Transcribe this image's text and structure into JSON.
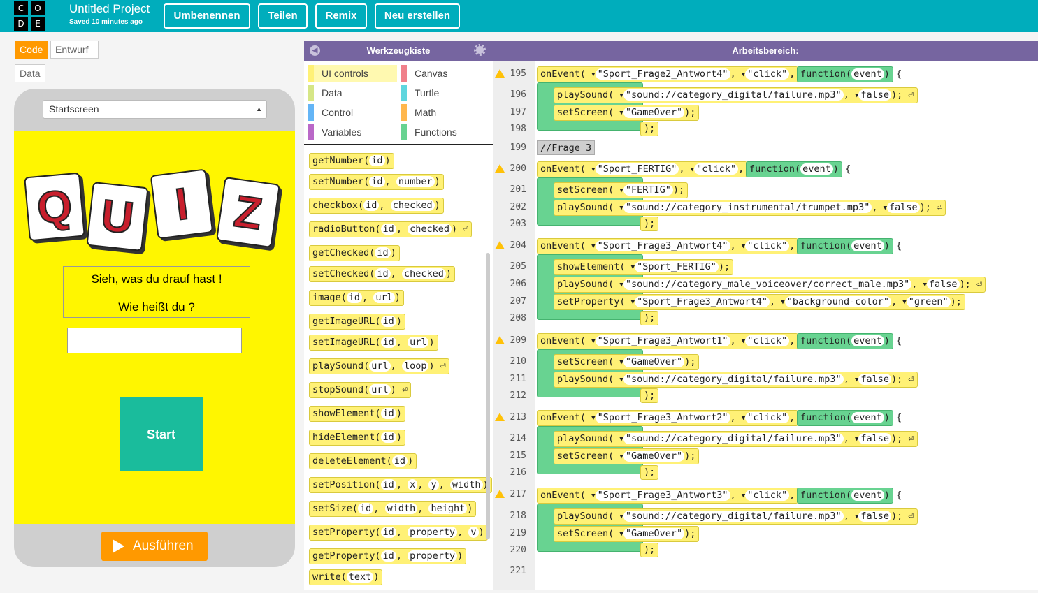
{
  "app": {
    "title": "Untitled Project",
    "saved": "Saved 10 minutes ago",
    "logo": [
      "C",
      "O",
      "D",
      "E"
    ],
    "buttons": {
      "rename": "Umbenennen",
      "share": "Teilen",
      "remix": "Remix",
      "new": "Neu erstellen"
    }
  },
  "mode": {
    "code": "Code",
    "design": "Entwurf",
    "data": "Data"
  },
  "preview": {
    "screen_select": "Startscreen",
    "quiz_letters": [
      "Q",
      "U",
      "I",
      "Z"
    ],
    "line1": "Sieh, was du drauf hast !",
    "line2": "Wie heißt du ?",
    "input_value": "",
    "start": "Start",
    "run": "Ausführen"
  },
  "toolbox": {
    "header": "Werkzeugkiste",
    "categories": [
      {
        "label": "UI controls",
        "color": "#fff176"
      },
      {
        "label": "Canvas",
        "color": "#f0808a"
      },
      {
        "label": "Data",
        "color": "#d6e686"
      },
      {
        "label": "Turtle",
        "color": "#5fd6de"
      },
      {
        "label": "Control",
        "color": "#64b5f6"
      },
      {
        "label": "Math",
        "color": "#ffb74d"
      },
      {
        "label": "Variables",
        "color": "#ba68c8"
      },
      {
        "label": "Functions",
        "color": "#68d391"
      }
    ],
    "blocks": [
      {
        "name": "getNumber",
        "params": [
          "id"
        ],
        "ret": false
      },
      {
        "name": "setNumber",
        "params": [
          "id",
          "number"
        ],
        "ret": false
      },
      {
        "name": "checkbox",
        "params": [
          "id",
          "checked"
        ],
        "ret": false
      },
      {
        "name": "radioButton",
        "params": [
          "id",
          "checked"
        ],
        "ret": true
      },
      {
        "name": "getChecked",
        "params": [
          "id"
        ],
        "ret": false
      },
      {
        "name": "setChecked",
        "params": [
          "id",
          "checked"
        ],
        "ret": false
      },
      {
        "name": "image",
        "params": [
          "id",
          "url"
        ],
        "ret": false
      },
      {
        "name": "getImageURL",
        "params": [
          "id"
        ],
        "ret": false
      },
      {
        "name": "setImageURL",
        "params": [
          "id",
          "url"
        ],
        "ret": false
      },
      {
        "name": "playSound",
        "params": [
          "url",
          "loop"
        ],
        "ret": true
      },
      {
        "name": "stopSound",
        "params": [
          "url"
        ],
        "ret": true
      },
      {
        "name": "showElement",
        "params": [
          "id"
        ],
        "ret": false
      },
      {
        "name": "hideElement",
        "params": [
          "id"
        ],
        "ret": false
      },
      {
        "name": "deleteElement",
        "params": [
          "id"
        ],
        "ret": false
      },
      {
        "name": "setPosition",
        "params": [
          "id",
          "x",
          "y",
          "width"
        ],
        "ret": false
      },
      {
        "name": "setSize",
        "params": [
          "id",
          "width",
          "height"
        ],
        "ret": false
      },
      {
        "name": "setProperty",
        "params": [
          "id",
          "property",
          "v"
        ],
        "ret": false
      },
      {
        "name": "getProperty",
        "params": [
          "id",
          "property"
        ],
        "ret": false
      },
      {
        "name": "write",
        "params": [
          "text"
        ],
        "ret": false
      }
    ]
  },
  "workspace": {
    "header": "Arbeitsbereich:",
    "lines": [
      "195",
      "196",
      "197",
      "198",
      "199",
      "200",
      "201",
      "202",
      "203",
      "204",
      "205",
      "206",
      "207",
      "208",
      "209",
      "210",
      "211",
      "212",
      "213",
      "214",
      "215",
      "216",
      "217",
      "218",
      "219",
      "220",
      "221"
    ],
    "comment": "Frage 3",
    "events": [
      {
        "id": "\"Sport_Frage2_Antwort4\"",
        "evt": "\"click\"",
        "body": [
          [
            "playSound",
            "\"sound://category_digital/failure.mp3\"",
            "false"
          ],
          [
            "setScreen",
            "\"GameOver\""
          ]
        ]
      },
      {
        "id": "\"Sport_FERTIG\"",
        "evt": "\"click\"",
        "body": [
          [
            "setScreen",
            "\"FERTIG\""
          ],
          [
            "playSound",
            "\"sound://category_instrumental/trumpet.mp3\"",
            "false"
          ]
        ]
      },
      {
        "id": "\"Sport_Frage3_Antwort4\"",
        "evt": "\"click\"",
        "body": [
          [
            "showElement",
            "\"Sport_FERTIG\""
          ],
          [
            "playSound",
            "\"sound://category_male_voiceover/correct_male.mp3\"",
            "false"
          ],
          [
            "setProperty",
            "\"Sport_Frage3_Antwort4\"",
            "\"background-color\"",
            "\"green\""
          ]
        ]
      },
      {
        "id": "\"Sport_Frage3_Antwort1\"",
        "evt": "\"click\"",
        "body": [
          [
            "setScreen",
            "\"GameOver\""
          ],
          [
            "playSound",
            "\"sound://category_digital/failure.mp3\"",
            "false"
          ]
        ]
      },
      {
        "id": "\"Sport_Frage3_Antwort2\"",
        "evt": "\"click\"",
        "body": [
          [
            "playSound",
            "\"sound://category_digital/failure.mp3\"",
            "false"
          ],
          [
            "setScreen",
            "\"GameOver\""
          ]
        ]
      },
      {
        "id": "\"Sport_Frage3_Antwort3\"",
        "evt": "\"click\"",
        "body": [
          [
            "playSound",
            "\"sound://category_digital/failure.mp3\"",
            "false"
          ],
          [
            "setScreen",
            "\"GameOver\""
          ]
        ]
      }
    ],
    "kw_onEvent": "onEvent",
    "kw_function": "function",
    "kw_event": "event"
  }
}
